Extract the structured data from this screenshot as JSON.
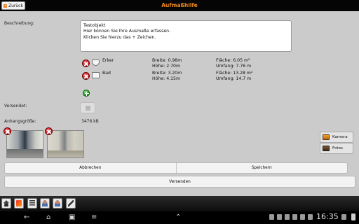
{
  "header": {
    "back_label": "Zurück",
    "title": "Aufmaßhilfe"
  },
  "form": {
    "description_label": "Beschreibung:",
    "description_lines": [
      "Testobjekt",
      "Hier können Sie Ihre Ausmaße erfassen.",
      "Klicken Sie hierzu das + Zeichen."
    ],
    "rooms": [
      {
        "name": "Erker",
        "shape_icon": "erker-shape-icon",
        "breite": "Breite: 0.98m",
        "hoehe": "Höhe: 2.70m",
        "flaeche": "Fläche: 6.05 m²",
        "umfang": "Umfang: 7.76 m"
      },
      {
        "name": "Bad",
        "shape_icon": "rectangle-shape-icon",
        "breite": "Breite: 3.20m",
        "hoehe": "Höhe: 4.15m",
        "flaeche": "Fläche: 13.28 m²",
        "umfang": "Umfang: 14.7 m"
      }
    ],
    "sent_label": "Versendet:",
    "sent_checked": false,
    "attachment_label": "Anhangsgröße:",
    "attachment_size": "3476 kB",
    "camera_label": "Kamera",
    "photos_label": "Fotos"
  },
  "actions": {
    "cancel_label": "Abbrechen",
    "save_label": "Speichern",
    "send_label": "Versenden"
  },
  "statusbar": {
    "time": "16:35"
  },
  "colors": {
    "title_accent": "#f08a1c",
    "delete_red": "#c0101a",
    "add_green": "#1f9a1f"
  }
}
